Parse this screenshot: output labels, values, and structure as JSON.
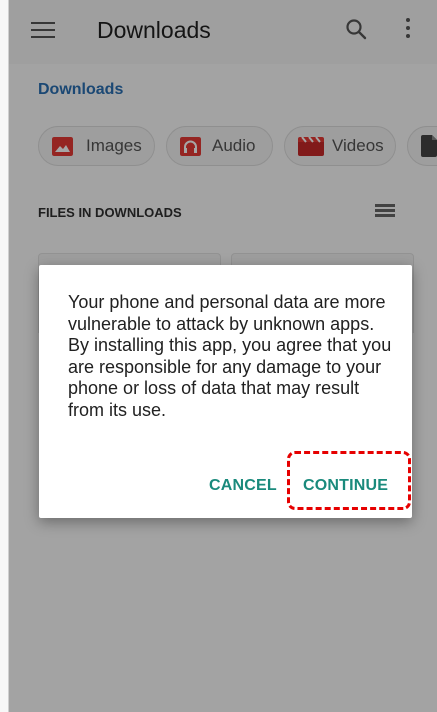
{
  "appbar": {
    "title": "Downloads"
  },
  "breadcrumb": "Downloads",
  "chips": [
    {
      "label": "Images",
      "icon": "image-icon",
      "color": "#e53935"
    },
    {
      "label": "Audio",
      "icon": "headphones-icon",
      "color": "#e53935"
    },
    {
      "label": "Videos",
      "icon": "clapperboard-icon",
      "color": "#e53935"
    },
    {
      "label": "",
      "icon": "document-icon",
      "color": "#444444"
    }
  ],
  "section": {
    "title": "FILES IN DOWNLOADS"
  },
  "dialog": {
    "message": "Your phone and personal data are more vulnerable to attack by unknown apps. By installing this app, you agree that you are responsible for any damage to your phone or loss of data that may result from its use.",
    "cancel_label": "CANCEL",
    "continue_label": "CONTINUE"
  },
  "colors": {
    "accent": "#1a8a7c",
    "link": "#2a6fb2",
    "highlight": "#e60000"
  }
}
